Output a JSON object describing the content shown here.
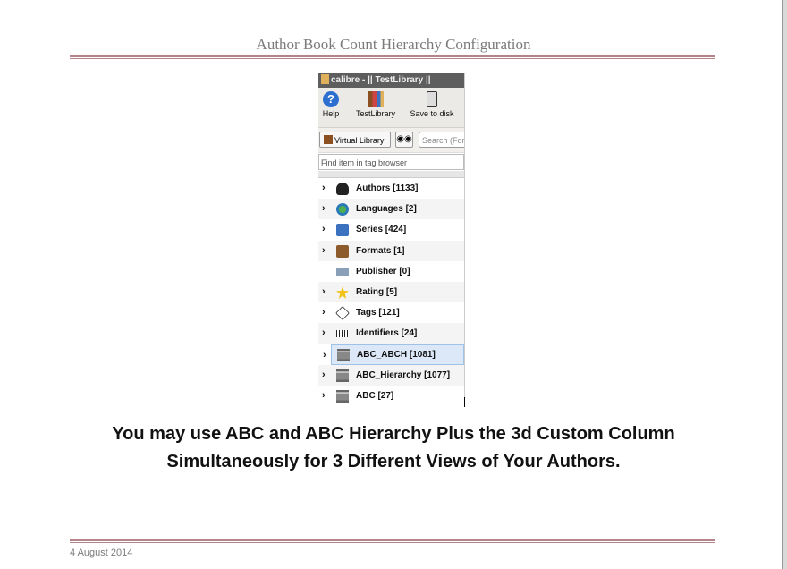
{
  "page": {
    "title": "Author Book Count Hierarchy Configuration",
    "caption_line1": "You may use ABC and ABC Hierarchy Plus the 3d Custom Column",
    "caption_line2": "Simultaneously for 3 Different Views of Your Authors.",
    "footer_date": "4 August 2014"
  },
  "calibre": {
    "window_title": "calibre - || TestLibrary ||",
    "toolbar": [
      {
        "label": "Help",
        "icon": "help-icon"
      },
      {
        "label": "TestLibrary",
        "icon": "library-icon"
      },
      {
        "label": "Save to disk",
        "icon": "save-disk-icon"
      }
    ],
    "virtual_library_label": "Virtual Library",
    "search_placeholder": "Search (For",
    "find_placeholder": "Find item in tag browser",
    "tree": [
      {
        "label": "Authors [1133]",
        "icon": "person-icon",
        "expander": true
      },
      {
        "label": "Languages [2]",
        "icon": "globe-icon",
        "expander": true
      },
      {
        "label": "Series [424]",
        "icon": "book-icon",
        "expander": true
      },
      {
        "label": "Formats [1]",
        "icon": "format-icon",
        "expander": true
      },
      {
        "label": "Publisher [0]",
        "icon": "publisher-icon",
        "expander": false
      },
      {
        "label": "Rating [5]",
        "icon": "star-icon",
        "expander": true
      },
      {
        "label": "Tags [121]",
        "icon": "tag-icon",
        "expander": true
      },
      {
        "label": "Identifiers [24]",
        "icon": "barcode-icon",
        "expander": true
      },
      {
        "label": "ABC_ABCH [1081]",
        "icon": "column-icon",
        "expander": true,
        "selected": true
      },
      {
        "label": "ABC_Hierarchy [1077]",
        "icon": "column-icon",
        "expander": true
      },
      {
        "label": "ABC [27]",
        "icon": "column-icon",
        "expander": true
      }
    ]
  }
}
